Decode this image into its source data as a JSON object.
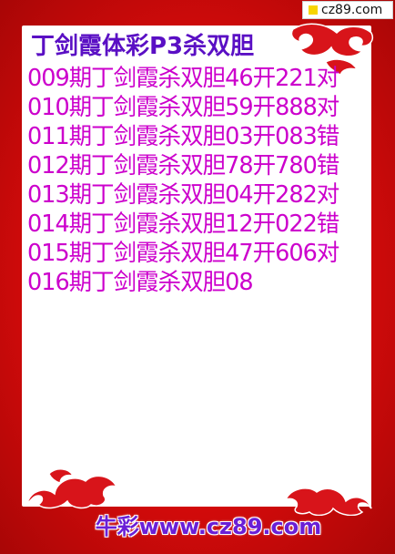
{
  "watermark": {
    "text": "cz89.com",
    "color": "#f7d400"
  },
  "title": "丁剑霞体彩P3杀双胆",
  "lines": [
    "009期丁剑霞杀双胆46开221对",
    "010期丁剑霞杀双胆59开888对",
    "011期丁剑霞杀双胆03开083错",
    "012期丁剑霞杀双胆78开780错",
    "013期丁剑霞杀双胆04开282对",
    "014期丁剑霞杀双胆12开022错",
    "015期丁剑霞杀双胆47开606对",
    "016期丁剑霞杀双胆08"
  ],
  "footer": "牛彩www.cz89.com",
  "colors": {
    "frame": "#d60b0b",
    "title": "#5a0fc4",
    "lines": "#cc00cc",
    "footer": "#6a1fd6"
  }
}
